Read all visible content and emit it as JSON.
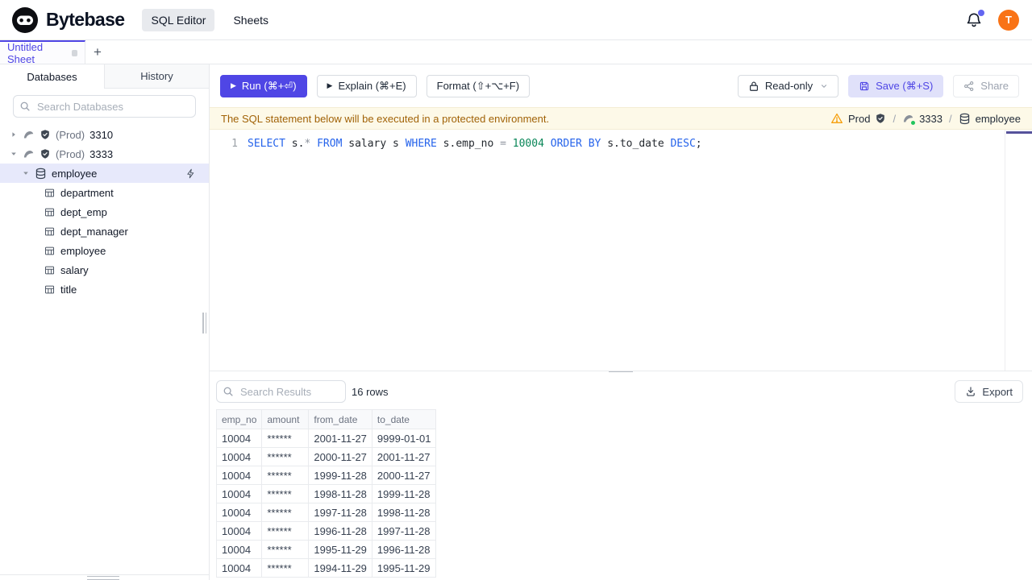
{
  "header": {
    "brand": "Bytebase",
    "nav": [
      {
        "label": "SQL Editor"
      },
      {
        "label": "Sheets"
      }
    ],
    "avatar_initial": "T"
  },
  "tabbar": {
    "sheet_title": "Untitled Sheet",
    "add_label": "+"
  },
  "sidebar": {
    "tabs": [
      {
        "label": "Databases"
      },
      {
        "label": "History"
      }
    ],
    "search_placeholder": "Search Databases",
    "instances": [
      {
        "env_label": "(Prod)",
        "name": "3310"
      },
      {
        "env_label": "(Prod)",
        "name": "3333"
      }
    ],
    "database": "employee",
    "tables": [
      "department",
      "dept_emp",
      "dept_manager",
      "employee",
      "salary",
      "title"
    ]
  },
  "toolbar": {
    "run_label": "Run (⌘+⏎)",
    "explain_label": "Explain (⌘+E)",
    "format_label": "Format (⇧+⌥+F)",
    "readonly_label": "Read-only",
    "save_label": "Save (⌘+S)",
    "share_label": "Share"
  },
  "banner": {
    "message": "The SQL statement below will be executed in a protected environment.",
    "environment": "Prod",
    "separator": "/",
    "instance": "3333",
    "database": "employee"
  },
  "editor": {
    "line_number": "1",
    "tokens": [
      {
        "text": "SELECT",
        "type": "kw"
      },
      {
        "text": " s.",
        "type": "plain"
      },
      {
        "text": "*",
        "type": "op"
      },
      {
        "text": " ",
        "type": "plain"
      },
      {
        "text": "FROM",
        "type": "kw"
      },
      {
        "text": " salary s ",
        "type": "plain"
      },
      {
        "text": "WHERE",
        "type": "kw"
      },
      {
        "text": " s.emp_no ",
        "type": "plain"
      },
      {
        "text": "=",
        "type": "op"
      },
      {
        "text": " ",
        "type": "plain"
      },
      {
        "text": "10004",
        "type": "num"
      },
      {
        "text": " ",
        "type": "plain"
      },
      {
        "text": "ORDER BY",
        "type": "kw"
      },
      {
        "text": " s.to_date ",
        "type": "plain"
      },
      {
        "text": "DESC",
        "type": "kw"
      },
      {
        "text": ";",
        "type": "plain"
      }
    ]
  },
  "results": {
    "search_placeholder": "Search Results",
    "row_count": "16 rows",
    "export_label": "Export",
    "columns": [
      "emp_no",
      "amount",
      "from_date",
      "to_date"
    ],
    "rows": [
      [
        "10004",
        "******",
        "2001-11-27",
        "9999-01-01"
      ],
      [
        "10004",
        "******",
        "2000-11-27",
        "2001-11-27"
      ],
      [
        "10004",
        "******",
        "1999-11-28",
        "2000-11-27"
      ],
      [
        "10004",
        "******",
        "1998-11-28",
        "1999-11-28"
      ],
      [
        "10004",
        "******",
        "1997-11-28",
        "1998-11-28"
      ],
      [
        "10004",
        "******",
        "1996-11-28",
        "1997-11-28"
      ],
      [
        "10004",
        "******",
        "1995-11-29",
        "1996-11-28"
      ],
      [
        "10004",
        "******",
        "1994-11-29",
        "1995-11-29"
      ]
    ]
  },
  "colors": {
    "accent": "#4f46e5",
    "avatar": "#f97316",
    "keyword": "#2563eb",
    "number": "#098658",
    "banner_text": "#a16207",
    "status_ok": "#22c55e"
  }
}
